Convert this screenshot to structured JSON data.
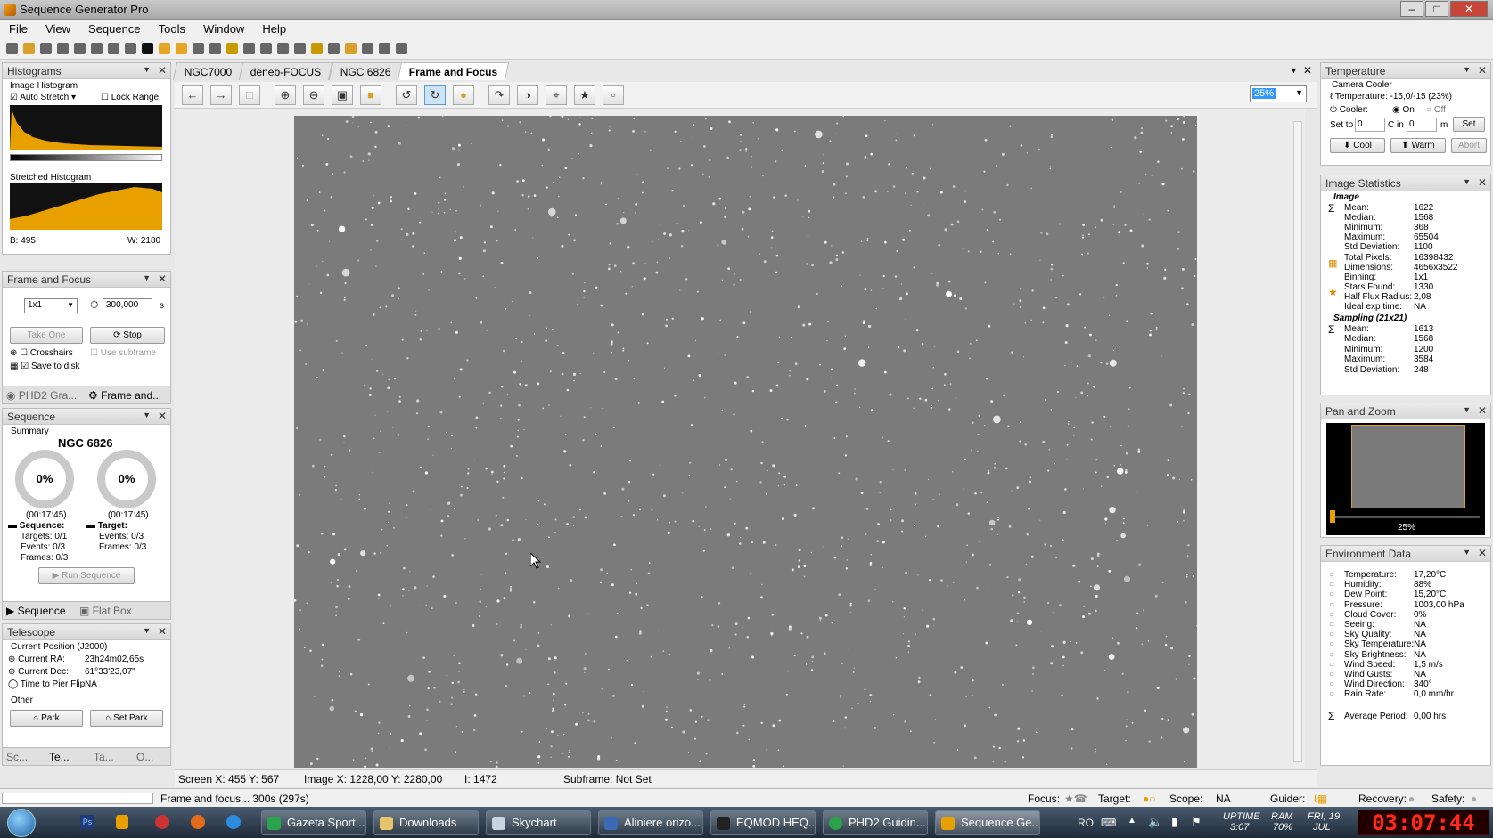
{
  "window": {
    "title": "Sequence Generator Pro"
  },
  "menu": [
    "File",
    "View",
    "Sequence",
    "Tools",
    "Window",
    "Help"
  ],
  "histograms": {
    "title": "Histograms",
    "image_histogram": "Image Histogram",
    "auto_stretch": "Auto Stretch",
    "lock_range": "Lock Range",
    "stretched_histogram": "Stretched Histogram",
    "b_label": "B: 495",
    "w_label": "W: 2180"
  },
  "frame_focus_panel": {
    "title": "Frame and Focus",
    "binning": "1x1",
    "exposure": "300,000",
    "unit": "s",
    "take_one": "Take One",
    "stop": "Stop",
    "crosshairs": "Crosshairs",
    "use_subframe": "Use subframe",
    "save_to_disk": "Save to disk",
    "tab_phd2": "PHD2 Gra...",
    "tab_frame": "Frame and..."
  },
  "sequence": {
    "title": "Sequence",
    "summary": "Summary",
    "target_name": "NGC 6826",
    "ring1_pct": "0%",
    "ring2_pct": "0%",
    "ring1_time": "(00:17:45)",
    "ring2_time": "(00:17:45)",
    "seq_label": "Sequence:",
    "target_label": "Target:",
    "targets": "Targets:  0/1",
    "events1": "Events:   0/3",
    "frames1": "Frames:   0/3",
    "events2": "Events:    0/3",
    "frames2": "Frames:    0/3",
    "run": "Run Sequence",
    "tab_sequence": "Sequence",
    "tab_flatbox": "Flat Box"
  },
  "telescope": {
    "title": "Telescope",
    "current_position": "Current Position (J2000)",
    "ra_label": "Current RA:",
    "ra": "23h24m02,65s",
    "dec_label": "Current Dec:",
    "dec": "61°33'23,07\"",
    "flip_label": "Time to Pier Flip:",
    "flip": "NA",
    "other": "Other",
    "park": "Park",
    "set_park": "Set Park",
    "bottom_tabs": [
      "Sc...",
      "Te...",
      "Ta...",
      "O..."
    ]
  },
  "tabs": [
    "NGC7000",
    "deneb-FOCUS",
    "NGC 6826",
    "Frame and Focus"
  ],
  "zoom": "25%",
  "image_status": {
    "screen": "Screen X: 455 Y: 567",
    "image": "Image X: 1228,00 Y: 2280,00",
    "i": "I: 1472",
    "subframe": "Subframe: Not Set"
  },
  "temperature": {
    "title": "Temperature",
    "camera_cooler": "Camera Cooler",
    "temp_text": "Temperature: -15,0/-15 (23%)",
    "cooler": "Cooler:",
    "on": "On",
    "off": "Off",
    "set_to": "Set to",
    "set_val": "0",
    "c_in": "C in",
    "in_val": "0",
    "m": "m",
    "set": "Set",
    "cool": "Cool",
    "warm": "Warm",
    "abort": "Abort"
  },
  "image_stats": {
    "title": "Image Statistics",
    "image_header": "Image",
    "rows": [
      [
        "Mean:",
        "1622"
      ],
      [
        "Median:",
        "1568"
      ],
      [
        "Minimum:",
        "368"
      ],
      [
        "Maximum:",
        "65504"
      ],
      [
        "Std Deviation:",
        "1100"
      ],
      [
        "Total Pixels:",
        "16398432"
      ],
      [
        "Dimensions:",
        "4656x3522"
      ],
      [
        "Binning:",
        "1x1"
      ],
      [
        "Stars Found:",
        "1330"
      ],
      [
        "Half Flux Radius:",
        "2,08"
      ],
      [
        "Ideal exp time:",
        "NA"
      ]
    ],
    "sampling_header": "Sampling (21x21)",
    "sampling_rows": [
      [
        "Mean:",
        "1613"
      ],
      [
        "Median:",
        "1568"
      ],
      [
        "Minimum:",
        "1200"
      ],
      [
        "Maximum:",
        "3584"
      ],
      [
        "Std Deviation:",
        "248"
      ]
    ]
  },
  "pan_zoom": {
    "title": "Pan and Zoom",
    "zoom_label": "25%"
  },
  "environment": {
    "title": "Environment Data",
    "rows": [
      [
        "Temperature:",
        "17,20°C"
      ],
      [
        "Humidity:",
        "88%"
      ],
      [
        "Dew Point:",
        "15,20°C"
      ],
      [
        "Pressure:",
        "1003,00 hPa"
      ],
      [
        "Cloud Cover:",
        "0%"
      ],
      [
        "Seeing:",
        "NA"
      ],
      [
        "Sky Quality:",
        "NA"
      ],
      [
        "Sky Temperature:",
        "NA"
      ],
      [
        "Sky Brightness:",
        "NA"
      ],
      [
        "Wind Speed:",
        "1,5 m/s"
      ],
      [
        "Wind Gusts:",
        "NA"
      ],
      [
        "Wind Direction:",
        "340°"
      ],
      [
        "Rain Rate:",
        "0,0 mm/hr"
      ]
    ],
    "avg_label": "Average Period:",
    "avg_val": "0,00 hrs"
  },
  "statusbar": {
    "message": "Frame and focus... 300s (297s)",
    "focus": "Focus:",
    "target": "Target:",
    "scope": "Scope:",
    "scope_val": "NA",
    "guider": "Guider:",
    "recovery": "Recovery:",
    "safety": "Safety:"
  },
  "taskbar": {
    "items": [
      "Gazeta Sport...",
      "Downloads",
      "Skychart",
      "Aliniere orizo...",
      "EQMOD HEQ...",
      "PHD2 Guidin...",
      "Sequence Ge..."
    ],
    "lang": "RO",
    "uptime": "UPTIME",
    "uptime_val": "3:07",
    "ram": "RAM",
    "ram_val": "70%",
    "day": "FRI, 19",
    "month": "JUL",
    "clock": "03:07:44"
  },
  "colors": {
    "histogram": "#e8a000",
    "accent": "#3399ff",
    "clock": "#ff2a1a"
  }
}
